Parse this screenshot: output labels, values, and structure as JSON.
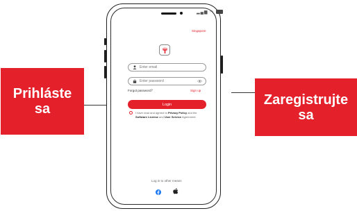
{
  "callouts": {
    "login": {
      "line1": "Prihláste",
      "line2": "sa"
    },
    "register": {
      "line1": "Zaregistrujte",
      "line2": "sa"
    }
  },
  "app": {
    "language": "Singapore",
    "email_placeholder": "Enter email",
    "password_placeholder": "Enter password",
    "forgot_password": "Forgot password？",
    "sign_up": "Sign up",
    "login_button": "Login",
    "agreement": {
      "prefix": "I have read and agreed to ",
      "privacy": "Privacy Policy",
      "middle": " and the ",
      "software_license": "Software License",
      "and": " and ",
      "user_service": "User Service",
      "suffix": " Agreement."
    },
    "other_means": "Log in to other means"
  },
  "colors": {
    "accent": "#e4202a",
    "frame": "#1e1e1e"
  },
  "icons": [
    "user-icon",
    "lock-icon",
    "eye-icon",
    "facebook-icon",
    "apple-icon",
    "app-logo-icon"
  ]
}
